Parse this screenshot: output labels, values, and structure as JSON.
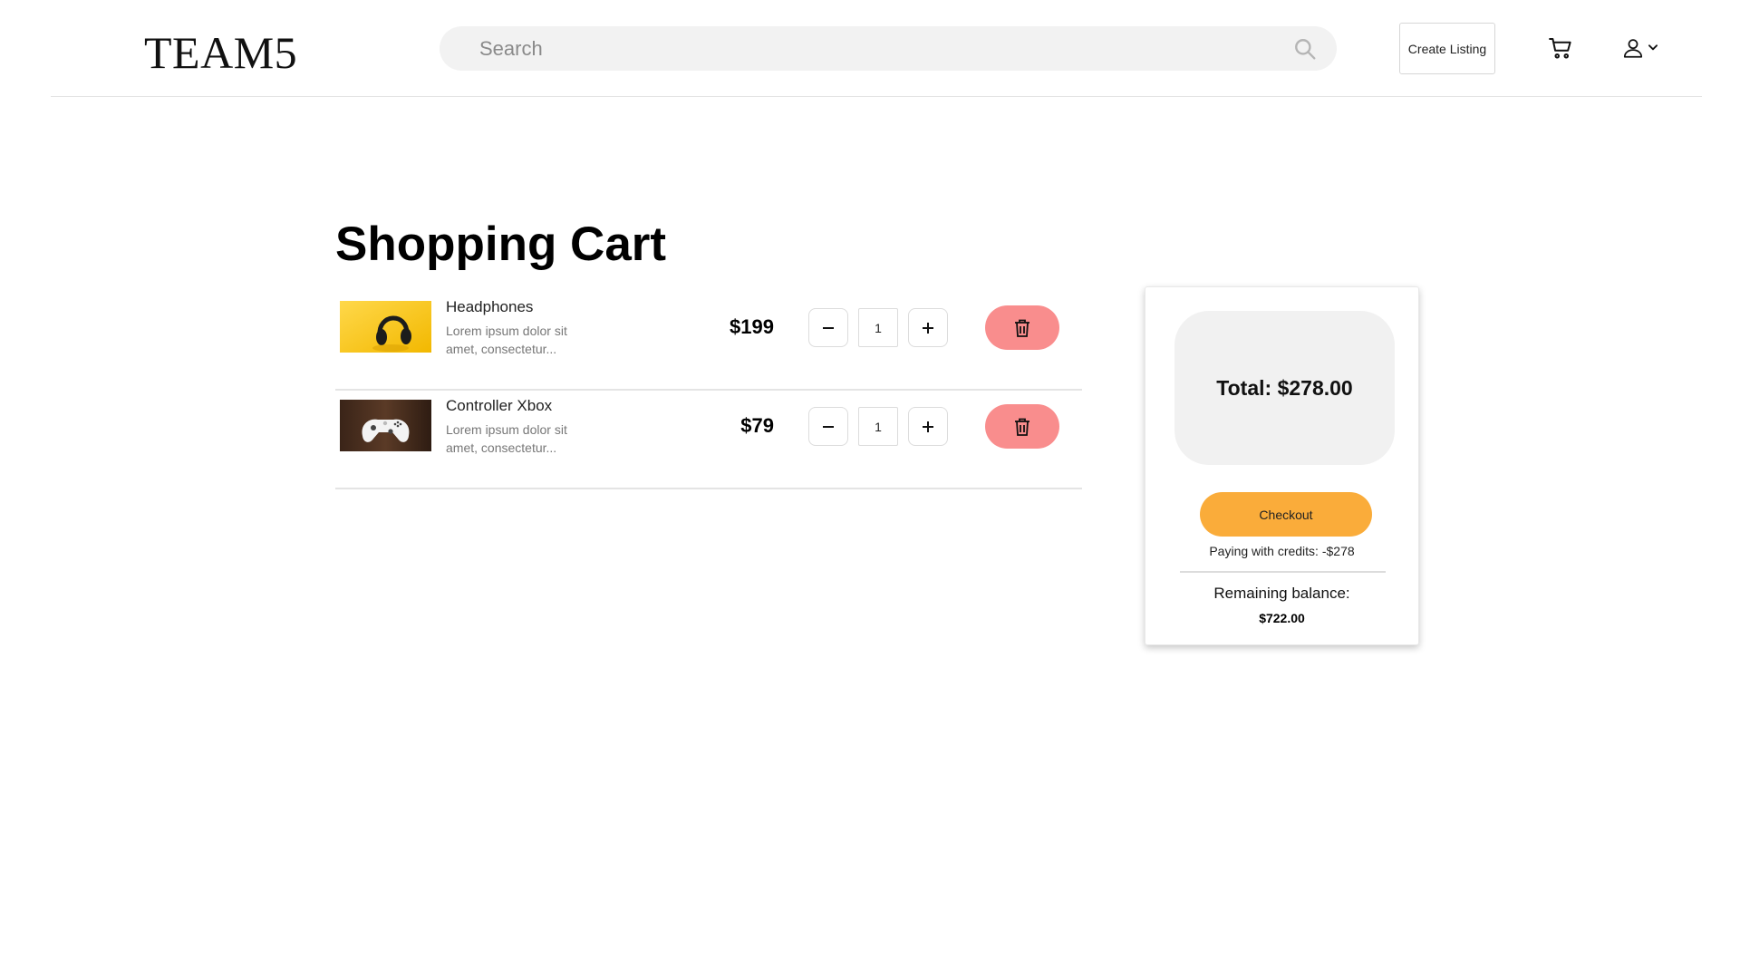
{
  "header": {
    "logo": "TEAM5",
    "search_placeholder": "Search",
    "create_listing_label": "Create Listing"
  },
  "main": {
    "title": "Shopping Cart",
    "items": [
      {
        "name": "Headphones",
        "description": "Lorem ipsum dolor sit amet, consectetur...",
        "price": "$199",
        "quantity": "1",
        "thumbnail": "headphones-image"
      },
      {
        "name": "Controller Xbox",
        "description": "Lorem ipsum dolor sit amet, consectetur...",
        "price": "$79",
        "quantity": "1",
        "thumbnail": "xbox-controller-image"
      }
    ]
  },
  "summary": {
    "total": "Total: $278.00",
    "checkout_label": "Checkout",
    "credits_text": "Paying with credits: -$278",
    "remaining_label": "Remaining balance:",
    "remaining_value": "$722.00"
  },
  "colors": {
    "checkout": "#faac3a",
    "delete": "#f98d8d",
    "total_box": "#f1f1f1",
    "search_bg": "#f2f2f2"
  }
}
